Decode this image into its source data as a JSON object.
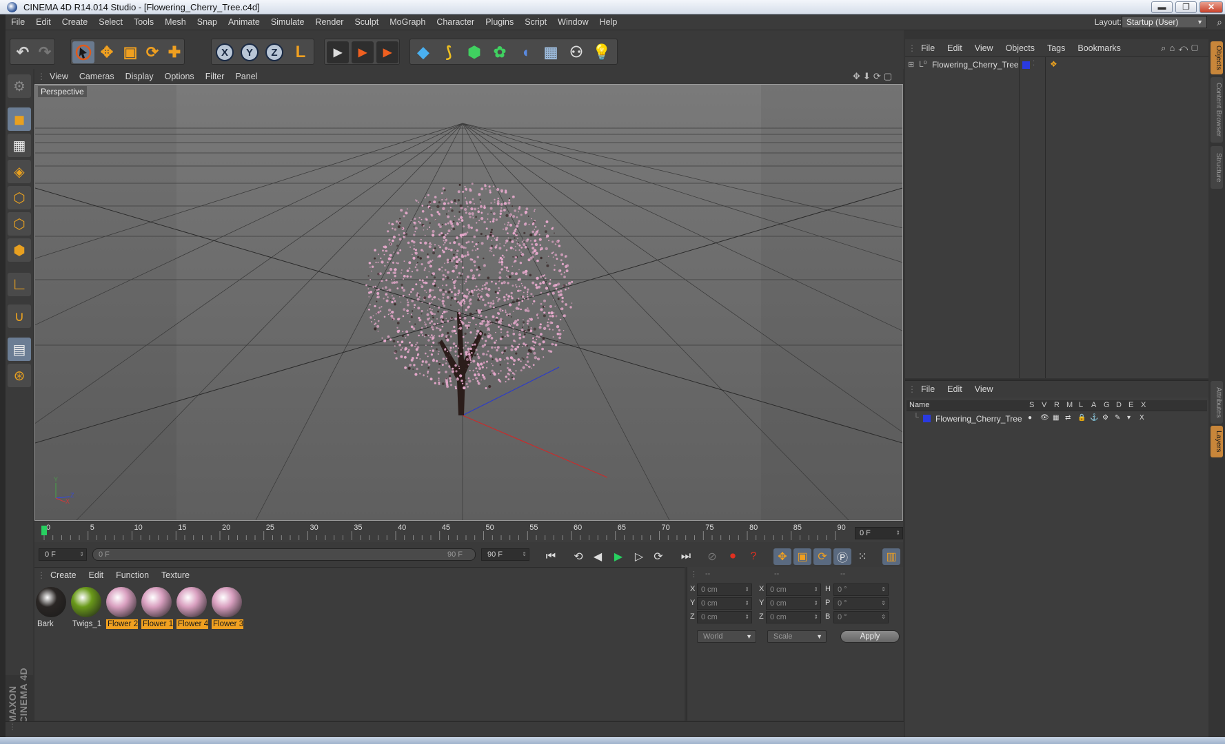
{
  "window": {
    "title": "CINEMA 4D R14.014 Studio - [Flowering_Cherry_Tree.c4d]",
    "minimize": "▬",
    "restore": "❐",
    "close": "✕"
  },
  "menubar": {
    "items": [
      "File",
      "Edit",
      "Create",
      "Select",
      "Tools",
      "Mesh",
      "Snap",
      "Animate",
      "Simulate",
      "Render",
      "Sculpt",
      "MoGraph",
      "Character",
      "Plugins",
      "Script",
      "Window",
      "Help"
    ],
    "layout_label": "Layout:",
    "layout_value": "Startup (User)"
  },
  "toolbar": {
    "undo_icon": "↶",
    "redo_icon": "↷",
    "move_icon": "✥",
    "scale_icon": "▣",
    "rotate_icon": "⟳",
    "add_icon": "✚",
    "axis_x": "X",
    "axis_y": "Y",
    "axis_z": "Z",
    "coord_icon": "L",
    "render_icons": [
      "▶",
      "▶",
      "▶"
    ],
    "object_icons": [
      "◆",
      "⟆",
      "⬢",
      "✿",
      "◖",
      "▦",
      "⚇",
      "💡"
    ]
  },
  "viewport": {
    "menu": [
      "View",
      "Cameras",
      "Display",
      "Options",
      "Filter",
      "Panel"
    ],
    "label": "Perspective",
    "nav_icons": "✥⬇⟳▢",
    "axis_labels": {
      "y": "Y",
      "z": "Z",
      "x": "X"
    }
  },
  "timeline": {
    "ticks": [
      "0",
      "5",
      "10",
      "15",
      "20",
      "25",
      "30",
      "35",
      "40",
      "45",
      "50",
      "55",
      "60",
      "65",
      "70",
      "75",
      "80",
      "85",
      "90"
    ],
    "current_frame": "0 F"
  },
  "transport": {
    "start_field": "0 F",
    "range_start": "0 F",
    "range_end": "90 F",
    "end_field": "90 F",
    "buttons": [
      "⏮",
      "⟲",
      "◀",
      "▶",
      "▷",
      "⟳",
      "⏭"
    ]
  },
  "material_manager": {
    "menu": [
      "Create",
      "Edit",
      "Function",
      "Texture"
    ],
    "materials": [
      {
        "name": "Bark",
        "color": "#2a2624",
        "highlight": false
      },
      {
        "name": "Twigs_1",
        "color": "#6a9a1a",
        "highlight": false
      },
      {
        "name": "Flower 2",
        "color": "#d9a0c0",
        "highlight": true
      },
      {
        "name": "Flower 1",
        "color": "#d9a0c0",
        "highlight": true
      },
      {
        "name": "Flower 4",
        "color": "#d9a0c0",
        "highlight": true
      },
      {
        "name": "Flower 3",
        "color": "#d9a0c0",
        "highlight": true
      }
    ]
  },
  "coord_manager": {
    "headers": [
      "--",
      "--",
      "--"
    ],
    "rows": [
      {
        "l1": "X",
        "v1": "0 cm",
        "l2": "X",
        "v2": "0 cm",
        "l3": "H",
        "v3": "0 °"
      },
      {
        "l1": "Y",
        "v1": "0 cm",
        "l2": "Y",
        "v2": "0 cm",
        "l3": "P",
        "v3": "0 °"
      },
      {
        "l1": "Z",
        "v1": "0 cm",
        "l2": "Z",
        "v2": "0 cm",
        "l3": "B",
        "v3": "0 °"
      }
    ],
    "space": "World",
    "mode": "Scale",
    "apply": "Apply"
  },
  "object_manager": {
    "menu": [
      "File",
      "Edit",
      "View",
      "Objects",
      "Tags",
      "Bookmarks"
    ],
    "object_name": "Flowering_Cherry_Tree"
  },
  "layer_manager": {
    "menu": [
      "File",
      "Edit",
      "View"
    ],
    "col_name": "Name",
    "cols": [
      "S",
      "V",
      "R",
      "M",
      "L",
      "A",
      "G",
      "D",
      "E",
      "X"
    ],
    "layer_name": "Flowering_Cherry_Tree"
  },
  "right_tabs": [
    "Objects",
    "Content Browser",
    "Structure",
    "Attributes",
    "Layers"
  ],
  "brand": "MAXON CINEMA 4D",
  "colors": {
    "accent_orange": "#f0a020",
    "axis_x": "#cc2a2a",
    "axis_z": "#2a3acc",
    "blossom": "#e6a9cc"
  }
}
